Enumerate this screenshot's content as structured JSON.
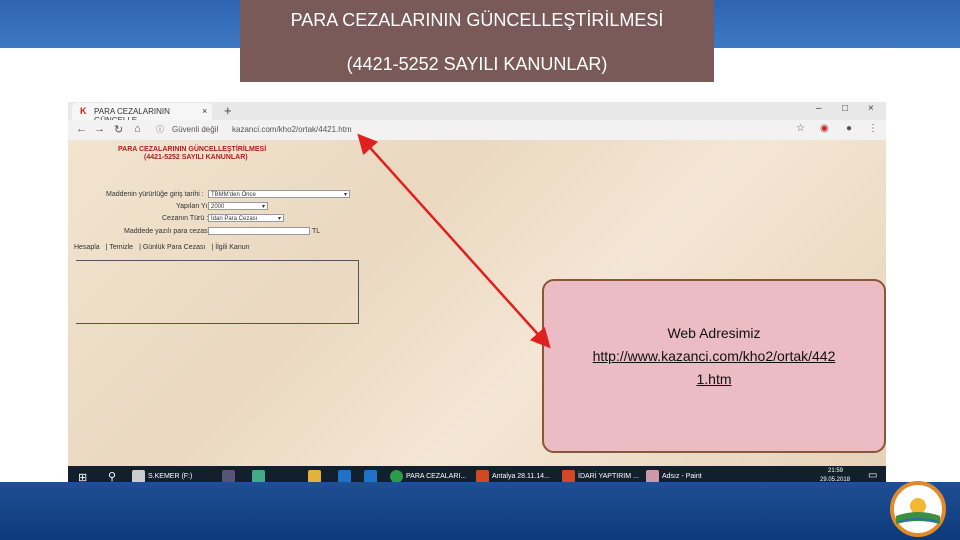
{
  "slide": {
    "title_line1": "PARA CEZALARININ GÜNCELLEŞTİRİLMESİ",
    "title_line2": "(4421-5252 SAYILI KANUNLAR)"
  },
  "browser": {
    "tab_title": "PARA CEZALARININ GÜNCELLE",
    "tab_close": "×",
    "new_tab": "+",
    "security": "Güvenli değil",
    "url": "kazanci.com/kho2/ortak/4421.htm",
    "win_min": "–",
    "win_max": "□",
    "win_close": "×"
  },
  "page": {
    "heading1": "PARA CEZALARININ GÜNCELLEŞTİRİLMESİ",
    "heading2": "(4421-5252 SAYILI KANUNLAR)",
    "fields": {
      "madde_label": "Maddenin yürürlüğe giriş tarihi :",
      "madde_value": "TBMM'den Önce",
      "year_label": "Yapılan Yıl :",
      "year_value": "2000",
      "ceza_label": "Cezanın Türü :",
      "ceza_value": "İdari Para Cezası",
      "miktar_label": "Maddede yazılı para cezası :",
      "currency": "TL"
    },
    "tabs": [
      "Hesapla",
      "Temizle",
      "Günlük Para Cezası",
      "İlgili Kanun"
    ]
  },
  "info": {
    "heading": "Web Adresimiz",
    "url_line1": "http://www.kazanci.com/kho2/ortak/442",
    "url_line2": "1.htm"
  },
  "taskbar": {
    "item1": "S.KEMER (F:)",
    "item2": "PARA CEZALARI...",
    "item3": "Antalya 28.11.14...",
    "item4": "İDARİ YAPTIRIM ...",
    "item5": "Adsız - Paint",
    "time": "21:59",
    "date": "29.05.2018"
  },
  "colors": {
    "title_bg": "#7a5a58",
    "band_blue": "#2f64b0",
    "info_bg": "#ecbcc4",
    "arrow": "#e02020"
  }
}
